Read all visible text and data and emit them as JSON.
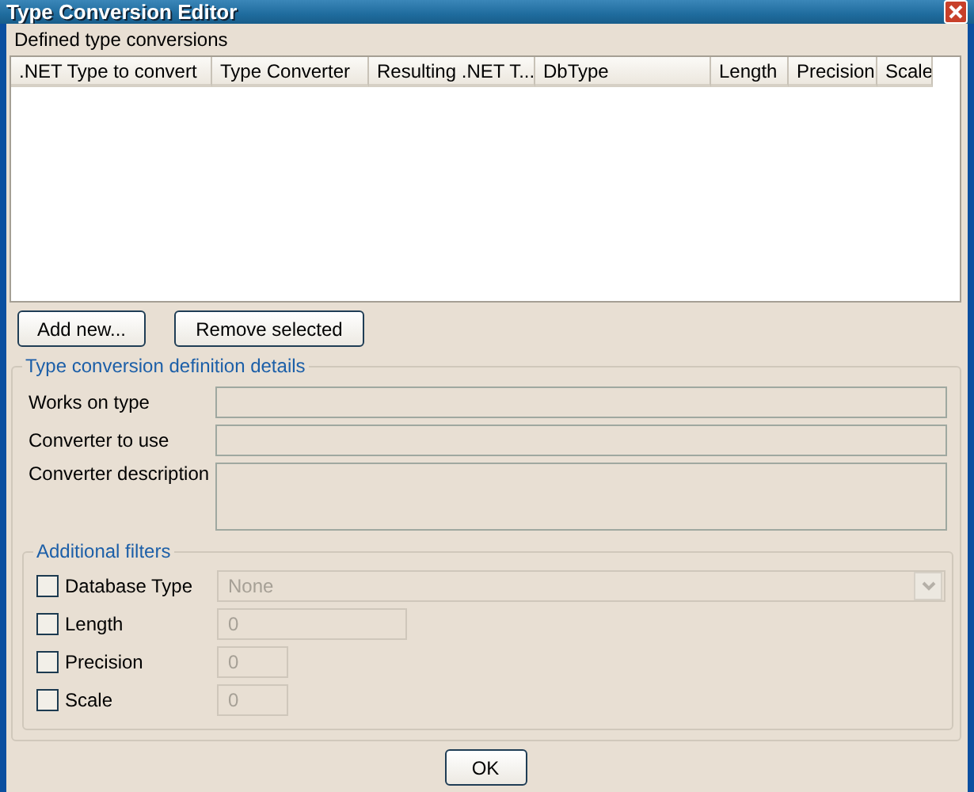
{
  "window": {
    "title": "Type Conversion Editor"
  },
  "list": {
    "label": "Defined type conversions",
    "columns": [
      ".NET Type to convert",
      "Type Converter",
      "Resulting .NET T...",
      "DbType",
      "Length",
      "Precision",
      "Scale"
    ]
  },
  "buttons": [
    "Add new...",
    "Remove selected"
  ],
  "details": {
    "title": "Type conversion definition details",
    "fields": [
      {
        "label": "Works on type",
        "kind": "line",
        "disabled": true
      },
      {
        "label": "Converter to use",
        "kind": "line",
        "disabled": true
      },
      {
        "label": "Converter description",
        "kind": "area",
        "disabled": true
      }
    ]
  },
  "filters": {
    "title": "Additional filters",
    "items": [
      {
        "label": "Database Type",
        "checked": false,
        "kind": "combo",
        "value": "None",
        "disabled": true
      },
      {
        "label": "Length",
        "checked": false,
        "kind": "wide",
        "value": "0",
        "disabled": true
      },
      {
        "label": "Precision",
        "checked": false,
        "kind": "narrow",
        "value": "0",
        "disabled": true
      },
      {
        "label": "Scale",
        "checked": false,
        "kind": "narrow",
        "value": "0",
        "disabled": true
      }
    ]
  },
  "ok_button": "OK"
}
